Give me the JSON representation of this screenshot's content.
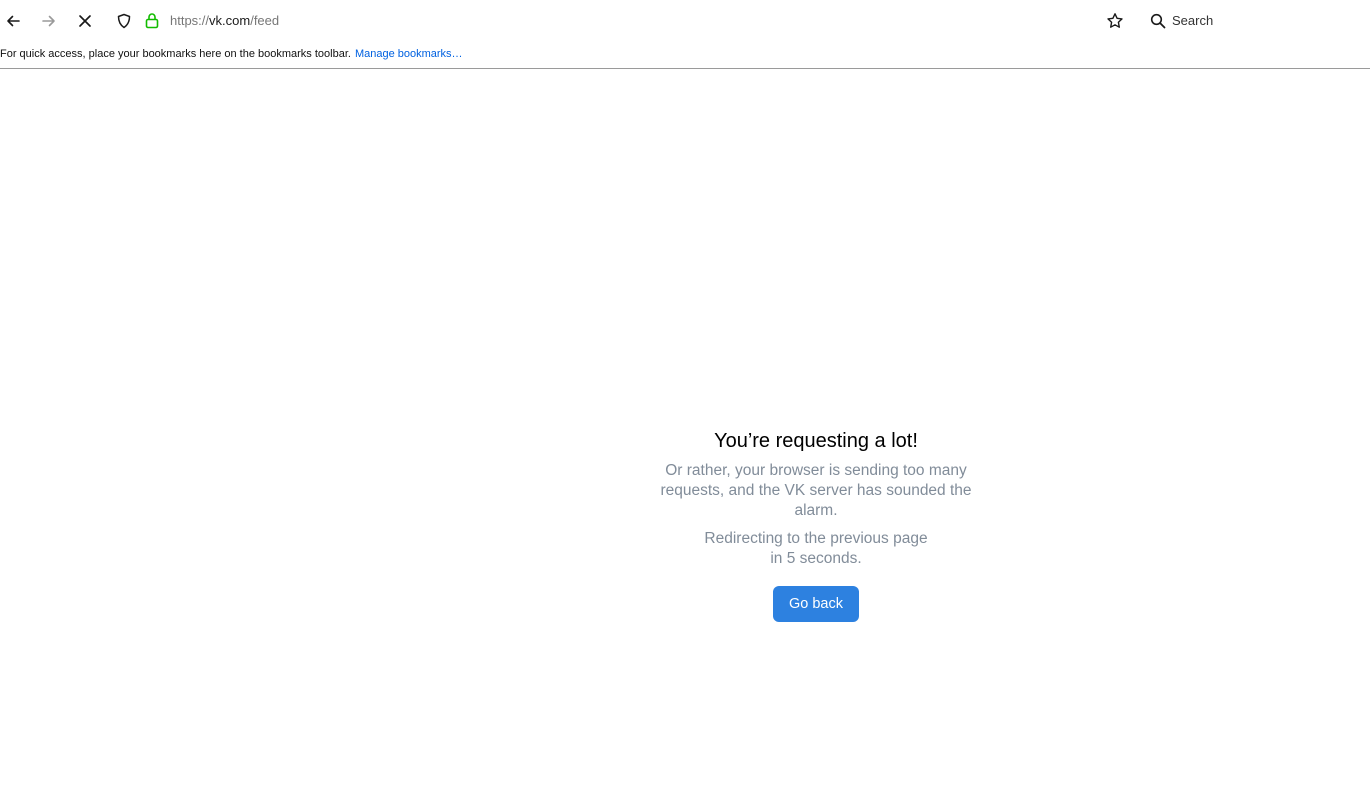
{
  "browser": {
    "url_scheme": "https://",
    "url_host": "vk.com",
    "url_path": "/feed",
    "search_placeholder": "Search"
  },
  "bookmarks_bar": {
    "message": "For quick access, place your bookmarks here on the bookmarks toolbar.",
    "manage_link": "Manage bookmarks…"
  },
  "page": {
    "headline": "You’re requesting a lot!",
    "description": "Or rather, your browser is sending too many requests, and the VK server has sounded the alarm.",
    "redirect_line1": "Redirecting to the previous page",
    "redirect_line2": "in 5 seconds.",
    "button_label": "Go back"
  },
  "colors": {
    "button_bg": "#2d81e0",
    "secondary_text": "#818c99",
    "lock_green": "#12bc00",
    "link_blue": "#0061e0"
  },
  "icons": [
    "back-arrow-icon",
    "forward-arrow-icon",
    "stop-loading-icon",
    "tracking-shield-icon",
    "lock-icon",
    "bookmark-star-icon",
    "search-icon"
  ]
}
